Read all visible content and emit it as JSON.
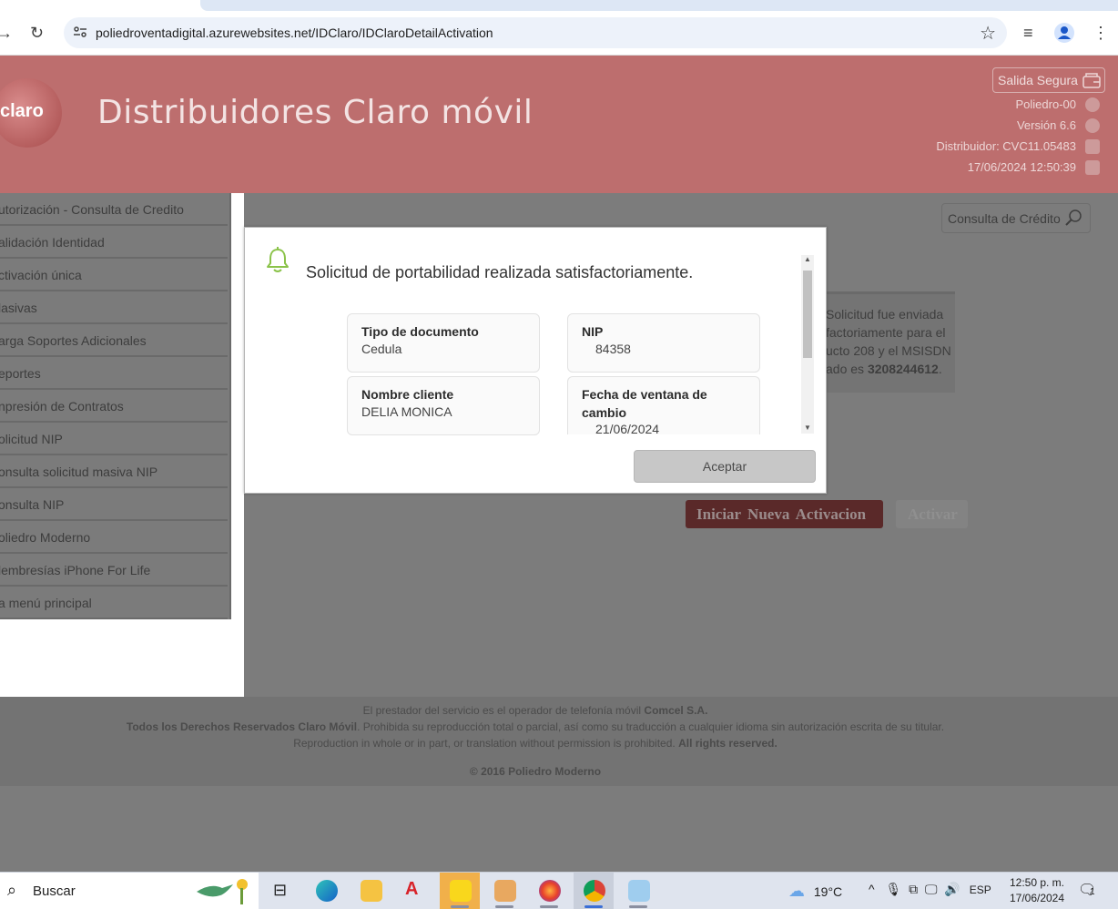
{
  "browser": {
    "url": "poliedroventadigital.azurewebsites.net/IDClaro/IDClaroDetailActivation"
  },
  "header": {
    "logo_text": "claro",
    "title": "Distribuidores Claro móvil",
    "secure_exit": "Salida Segura",
    "user": "Poliedro-00",
    "version": "Versión 6.6",
    "distributor": "Distribuidor: CVC11.05483",
    "datetime": "17/06/2024 12:50:39"
  },
  "sidebar": {
    "items": [
      {
        "label": "utorización - Consulta de Credito"
      },
      {
        "label": "alidación Identidad"
      },
      {
        "label": "ctivación única"
      },
      {
        "label": "lasivas"
      },
      {
        "label": "arga Soportes Adicionales"
      },
      {
        "label": "eportes"
      },
      {
        "label": "npresión de Contratos"
      },
      {
        "label": "olicitud NIP"
      },
      {
        "label": "onsulta solicitud masiva NIP"
      },
      {
        "label": "onsulta NIP"
      },
      {
        "label": "oliedro Moderno"
      },
      {
        "label": "lembresías iPhone For Life"
      },
      {
        "label": " a menú principal"
      }
    ]
  },
  "content": {
    "credit_button": "Consulta de Crédito",
    "notice_lines": [
      "Solicitud fue enviada",
      "factoriamente para el",
      "ucto 208 y el MSISDN"
    ],
    "notice_line4_prefix": "ado es ",
    "notice_msisdn": "3208244612",
    "notice_line4_suffix": ".",
    "btn_new_activation": "Iniciar Nueva Activacion",
    "btn_activate": "Activar"
  },
  "footer": {
    "line1_text": "El prestador del servicio es el operador de telefonía móvil ",
    "line1_bold": "Comcel S.A.",
    "line2_bold": "Todos los Derechos Reservados Claro Móvil",
    "line2_text": ". Prohibida su reproducción total o parcial, así como su traducción a cualquier idioma sin autorización escrita de su titular.",
    "line3_text": "Reproduction in whole or in part, or translation without permission is prohibited. ",
    "line3_bold": "All rights reserved.",
    "copyright": "© 2016 Poliedro Moderno"
  },
  "modal": {
    "title": "Solicitud de portabilidad realizada satisfactoriamente.",
    "fields": [
      {
        "label": "Tipo de documento",
        "value": "Cedula"
      },
      {
        "label": "NIP",
        "value": "84358"
      },
      {
        "label": "Nombre cliente",
        "value": "DELIA MONICA"
      },
      {
        "label": "Fecha de ventana de cambio",
        "value": "21/06/2024"
      }
    ],
    "ok_button": "Aceptar"
  },
  "taskbar": {
    "search_label": "Buscar",
    "temperature": "19°C",
    "language": "ESP",
    "time": "12:50 p. m.",
    "date": "17/06/2024",
    "notification_count": "1"
  },
  "colors": {
    "header_bg": "#bd6e6e",
    "overlay_gray": "#7c7c7c",
    "bell_green": "#8bc34a"
  }
}
